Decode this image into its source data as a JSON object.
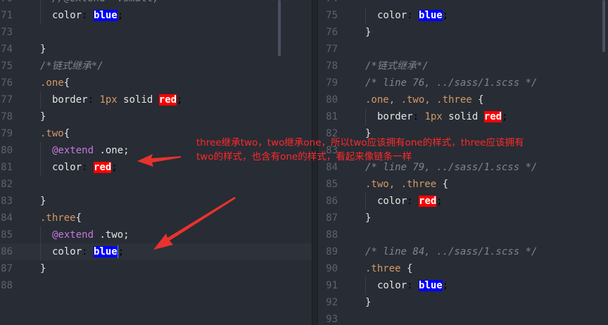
{
  "left": {
    "lines": [
      {
        "n": "70",
        "kind": "comment",
        "ind": 1,
        "text": "//@extend  .small;"
      },
      {
        "n": "71",
        "kind": "color",
        "ind": 1,
        "value": "blue",
        "swatch": "blue"
      },
      {
        "n": "73",
        "kind": "blank"
      },
      {
        "n": "74",
        "kind": "plain",
        "text": "}"
      },
      {
        "n": "75",
        "kind": "comment",
        "text": "/*链式继承*/"
      },
      {
        "n": "76",
        "kind": "selopen",
        "sel": ".one",
        "rest": "{"
      },
      {
        "n": "77",
        "kind": "border",
        "ind": 1,
        "value": "red"
      },
      {
        "n": "78",
        "kind": "plain",
        "text": "}"
      },
      {
        "n": "79",
        "kind": "selopen",
        "sel": ".two",
        "rest": "{"
      },
      {
        "n": "80",
        "kind": "extend",
        "ind": 1,
        "target": ".one;"
      },
      {
        "n": "81",
        "kind": "color",
        "ind": 1,
        "value": "red",
        "swatch": "red"
      },
      {
        "n": "82",
        "kind": "blank"
      },
      {
        "n": "83",
        "kind": "plain",
        "text": "}"
      },
      {
        "n": "84",
        "kind": "selopen",
        "sel": ".three",
        "rest": "{"
      },
      {
        "n": "85",
        "kind": "extend",
        "ind": 1,
        "target": ".two;"
      },
      {
        "n": "86",
        "kind": "color",
        "ind": 1,
        "value": "blue",
        "swatch": "blue",
        "current": true,
        "cursor": true
      },
      {
        "n": "87",
        "kind": "plain",
        "text": "}"
      },
      {
        "n": "88",
        "kind": "blank"
      }
    ]
  },
  "right": {
    "lines": [
      {
        "n": "74",
        "kind": "blank"
      },
      {
        "n": "75",
        "kind": "color",
        "ind": 1,
        "value": "blue",
        "swatch": "blue"
      },
      {
        "n": "76",
        "kind": "plain",
        "text": "}"
      },
      {
        "n": "77",
        "kind": "blank"
      },
      {
        "n": "78",
        "kind": "comment",
        "text": "/*链式继承*/"
      },
      {
        "n": "79",
        "kind": "comment",
        "text": "/* line 76, ../sass/1.scss */"
      },
      {
        "n": "80",
        "kind": "selopen",
        "sel": ".one, .two, .three",
        "rest": " {"
      },
      {
        "n": "81",
        "kind": "border",
        "ind": 1,
        "value": "red"
      },
      {
        "n": "82",
        "kind": "plain",
        "text": "}"
      },
      {
        "n": "83",
        "kind": "blank"
      },
      {
        "n": "84",
        "kind": "comment",
        "text": "/* line 79, ../sass/1.scss */"
      },
      {
        "n": "85",
        "kind": "selopen",
        "sel": ".two, .three",
        "rest": " {"
      },
      {
        "n": "86",
        "kind": "color",
        "ind": 1,
        "value": "red",
        "swatch": "red"
      },
      {
        "n": "87",
        "kind": "plain",
        "text": "}"
      },
      {
        "n": "88",
        "kind": "blank"
      },
      {
        "n": "89",
        "kind": "comment",
        "text": "/* line 84, ../sass/1.scss */"
      },
      {
        "n": "90",
        "kind": "selopen",
        "sel": ".three",
        "rest": " {"
      },
      {
        "n": "91",
        "kind": "color",
        "ind": 1,
        "value": "blue",
        "swatch": "blue"
      },
      {
        "n": "92",
        "kind": "plain",
        "text": "}"
      },
      {
        "n": "93",
        "kind": "blank"
      }
    ]
  },
  "tokens": {
    "color_prop": "color",
    "border_prop": "border",
    "border_width": "1px",
    "border_style": "solid",
    "extend_kw": "@extend"
  },
  "annotation": {
    "line1": "three继承two，two继承one，所以two应该拥有one的样式，three应该拥有",
    "line2": "two的样式，也含有one的样式，看起来像链条一样",
    "color": "#ff2a2a"
  }
}
